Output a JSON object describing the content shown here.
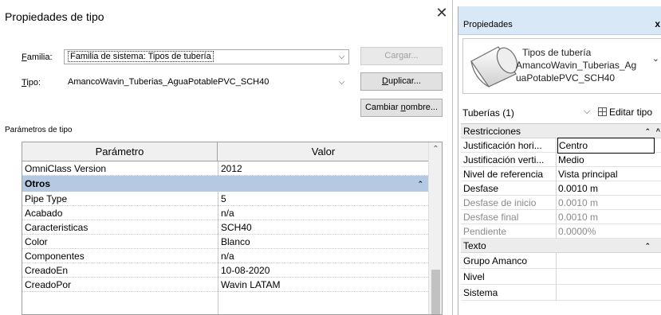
{
  "dialog": {
    "title": "Propiedades de tipo",
    "close_glyph": "✕",
    "familia_label": "Familia:",
    "familia_value": "Familia de sistema: Tipos de tubería",
    "tipo_label": "Tipo:",
    "tipo_value": "AmancoWavin_Tuberias_AguaPotablePVC_SCH40",
    "cargar_label": "Cargar...",
    "duplicar_label": "Duplicar...",
    "cambiar_label": "Cambiar nombre...",
    "section_label": "Parámetros de tipo",
    "table": {
      "col_param": "Parámetro",
      "col_valor": "Valor",
      "first_row": {
        "param": "OmniClass Version",
        "value": "2012"
      },
      "group": "Otros",
      "rows": [
        {
          "param": "Pipe Type",
          "value": "5"
        },
        {
          "param": "Acabado",
          "value": "n/a"
        },
        {
          "param": "Caracteristicas",
          "value": "SCH40"
        },
        {
          "param": "Color",
          "value": "Blanco"
        },
        {
          "param": "Componentes",
          "value": "n/a"
        },
        {
          "param": "CreadoEn",
          "value": "10-08-2020"
        },
        {
          "param": "CreadoPor",
          "value": "Wavin LATAM"
        }
      ]
    },
    "icons": [
      "close-icon",
      "chevron-down-icon",
      "collapse-icon",
      "scroll-up-icon"
    ]
  },
  "panel": {
    "title": "Propiedades",
    "close_glyph": "x",
    "type_name_lines": [
      "Tipos de tubería",
      "AmancoWavin_Tuberias_Ag",
      "uaPotablePVC_SCH40"
    ],
    "category": "Tuberías (1)",
    "edit_type": "Editar tipo",
    "sections": {
      "restricciones": "Restricciones",
      "texto": "Texto"
    },
    "restricciones_rows": [
      {
        "key": "Justificación hori...",
        "value": "Centro",
        "dim": false
      },
      {
        "key": "Justificación verti...",
        "value": "Medio",
        "dim": false
      },
      {
        "key": "Nivel de referencia",
        "value": "Vista principal",
        "dim": false
      },
      {
        "key": "Desfase",
        "value": "0.0010 m",
        "dim": false
      },
      {
        "key": "Desfase de inicio",
        "value": "0.0010 m",
        "dim": true
      },
      {
        "key": "Desfase final",
        "value": "0.0010 m",
        "dim": true
      },
      {
        "key": "Pendiente",
        "value": "0.0000%",
        "dim": true
      }
    ],
    "texto_rows": [
      {
        "key": "Grupo Amanco",
        "value": ""
      },
      {
        "key": "Nivel",
        "value": ""
      },
      {
        "key": "Sistema",
        "value": ""
      }
    ],
    "colors": {
      "title_bar": "#d9e8f6",
      "group_header": "#b6c9e3"
    }
  }
}
